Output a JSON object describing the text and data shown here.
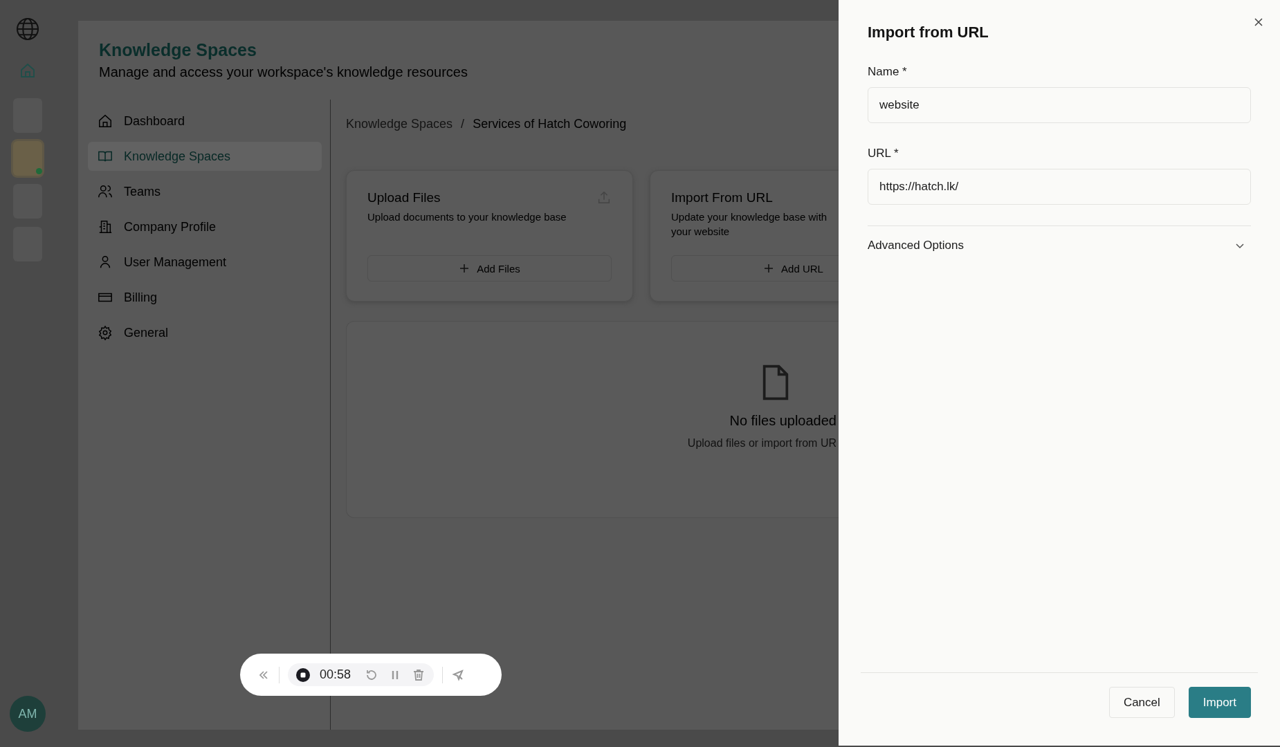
{
  "rail": {
    "avatars": [
      {
        "selected": false,
        "online": false
      },
      {
        "selected": true,
        "online": true
      },
      {
        "selected": false,
        "online": false
      },
      {
        "selected": false,
        "online": false
      }
    ],
    "user_initials": "AM"
  },
  "header": {
    "title": "Knowledge Spaces",
    "subtitle": "Manage and access your workspace's knowledge resources"
  },
  "nav": [
    {
      "label": "Dashboard",
      "selected": false
    },
    {
      "label": "Knowledge Spaces",
      "selected": true
    },
    {
      "label": "Teams",
      "selected": false
    },
    {
      "label": "Company Profile",
      "selected": false
    },
    {
      "label": "User Management",
      "selected": false
    },
    {
      "label": "Billing",
      "selected": false
    },
    {
      "label": "General",
      "selected": false
    }
  ],
  "breadcrumb": [
    "Knowledge Spaces",
    "/",
    "Services of Hatch Coworing"
  ],
  "cards": [
    {
      "title": "Upload Files",
      "description_lines": [
        "Upload documents to your knowledge base"
      ],
      "button": "Add Files",
      "kind": "upload"
    },
    {
      "title": "Import From URL",
      "description_lines": [
        "Update your knowledge base with",
        "your website"
      ],
      "button": "Add URL",
      "kind": "url"
    }
  ],
  "empty_state": {
    "title": "No files uploaded",
    "hint": "Upload files or import from UR"
  },
  "recorder": {
    "time": "00:58"
  },
  "drawer": {
    "title": "Import from URL",
    "fields": [
      {
        "label": "Name *",
        "value": "website"
      },
      {
        "label": "URL *",
        "value": "https://hatch.lk/"
      }
    ],
    "advanced": {
      "label": "Advanced Options",
      "expanded": false
    },
    "buttons": [
      {
        "label": "Cancel",
        "kind": "secondary"
      },
      {
        "label": "Import",
        "kind": "primary"
      }
    ]
  }
}
